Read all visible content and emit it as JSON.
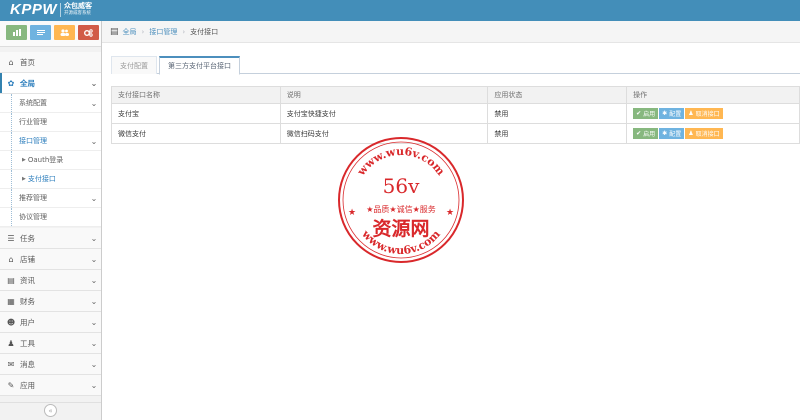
{
  "brand": {
    "logo": "KPPW",
    "name": "众包威客",
    "tagline": "开源威客系统"
  },
  "shortcuts": [
    {
      "name": "stats-shortcut",
      "icon": "chart-icon",
      "color": "#87b87f"
    },
    {
      "name": "edit-shortcut",
      "icon": "pencil-icon",
      "color": "#6fb3e0"
    },
    {
      "name": "users-shortcut",
      "icon": "users-icon",
      "color": "#ffb752"
    },
    {
      "name": "settings-shortcut",
      "icon": "cogs-icon",
      "color": "#d15b47"
    }
  ],
  "sidebar": {
    "home": "首页",
    "global": "全局",
    "sub": {
      "system_config": "系统配置",
      "industry": "行业管理",
      "interface": "接口管理",
      "oauth": "Oauth登录",
      "payment": "支付接口",
      "recommend": "推荐管理",
      "agreement": "协议管理"
    },
    "items": {
      "task": "任务",
      "shop": "店铺",
      "news": "资讯",
      "finance": "财务",
      "user": "用户",
      "tools": "工具",
      "message": "消息",
      "apps": "应用"
    }
  },
  "breadcrumb": {
    "home": "全局",
    "level2": "接口管理",
    "current": "支付接口"
  },
  "tabs": {
    "config": "支付配置",
    "third_party": "第三方支付平台接口"
  },
  "table": {
    "headers": {
      "name": "支付接口名称",
      "desc": "说明",
      "status": "应用状态",
      "ops": "操作"
    },
    "rows": [
      {
        "name": "支付宝",
        "desc": "支付宝快捷支付",
        "status": "禁用"
      },
      {
        "name": "微信支付",
        "desc": "微信扫码支付",
        "status": "禁用"
      }
    ],
    "actions": {
      "enable": "启用",
      "config": "配置",
      "disable": "取消接口"
    }
  },
  "watermark": {
    "url_top": "www.wu6v.com",
    "url_bottom": "www.wu6v.com",
    "code": "56v",
    "slogan": "★品质★诚信★服务",
    "title": "资源网",
    "color": "#d9282b"
  }
}
